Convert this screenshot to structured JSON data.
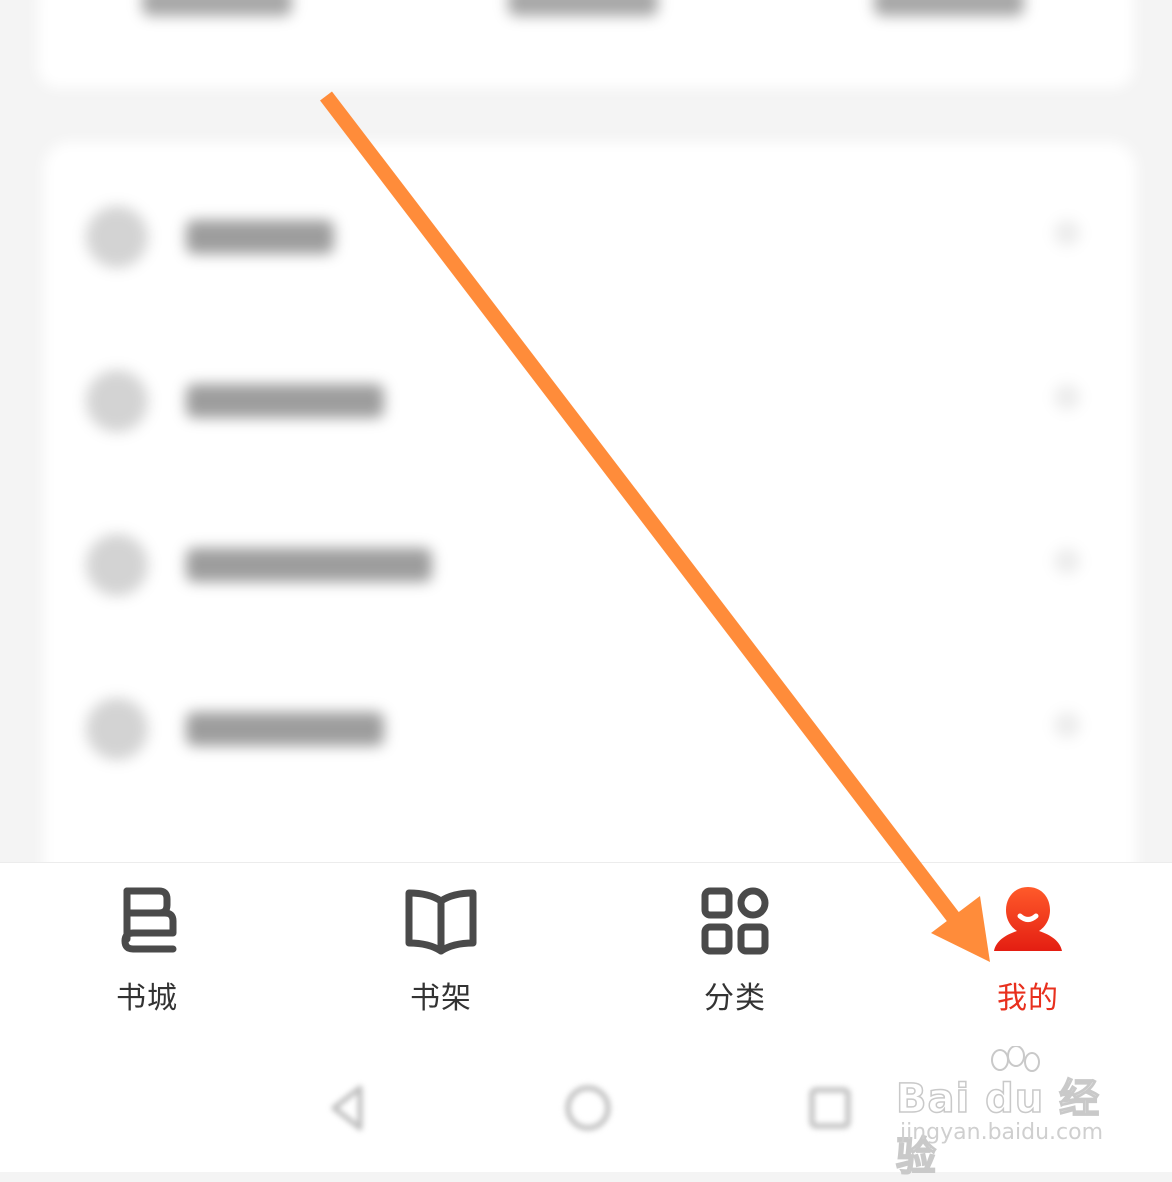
{
  "bottom_nav": {
    "items": [
      {
        "label": "书城",
        "icon": "bookstore-icon",
        "active": false
      },
      {
        "label": "书架",
        "icon": "bookshelf-icon",
        "active": false
      },
      {
        "label": "分类",
        "icon": "category-grid-icon",
        "active": false
      },
      {
        "label": "我的",
        "icon": "profile-icon",
        "active": true
      }
    ]
  },
  "gesture_bar": {
    "buttons": [
      "back-icon",
      "home-icon",
      "recents-icon"
    ]
  },
  "watermark": {
    "main": "Bai du 经验",
    "sub": "jingyan.baidu.com"
  },
  "colors": {
    "accent": "#e8301e",
    "nav_text": "#333333",
    "nav_icon": "#4a4a4a",
    "arrow": "#ff8c3a"
  }
}
